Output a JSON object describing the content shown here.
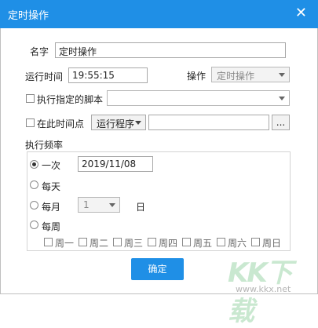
{
  "window": {
    "title": "定时操作",
    "close": "✕"
  },
  "form": {
    "name_label": "名字",
    "name_value": "定时操作",
    "run_time_label": "运行时间",
    "run_time_value": "19:55:15",
    "operation_label": "操作",
    "operation_value": "定时操作",
    "script_label": "执行指定的脚本",
    "script_checked": false,
    "timepoint_label": "在此时间点",
    "timepoint_checked": false,
    "run_program_button": "运行程序",
    "browse_button": "..."
  },
  "frequency": {
    "label": "执行频率",
    "once_label": "一次",
    "once_date": "2019/11/08",
    "daily_label": "每天",
    "monthly_label": "每月",
    "monthly_day": "1",
    "monthly_suffix": "日",
    "weekly_label": "每周",
    "selected": "once",
    "weekdays": [
      "周一",
      "周二",
      "周三",
      "周四",
      "周五",
      "周六",
      "周日"
    ]
  },
  "ok_button": "确定",
  "watermark": {
    "logo": "KK下载",
    "url": "www.kkx.net"
  }
}
